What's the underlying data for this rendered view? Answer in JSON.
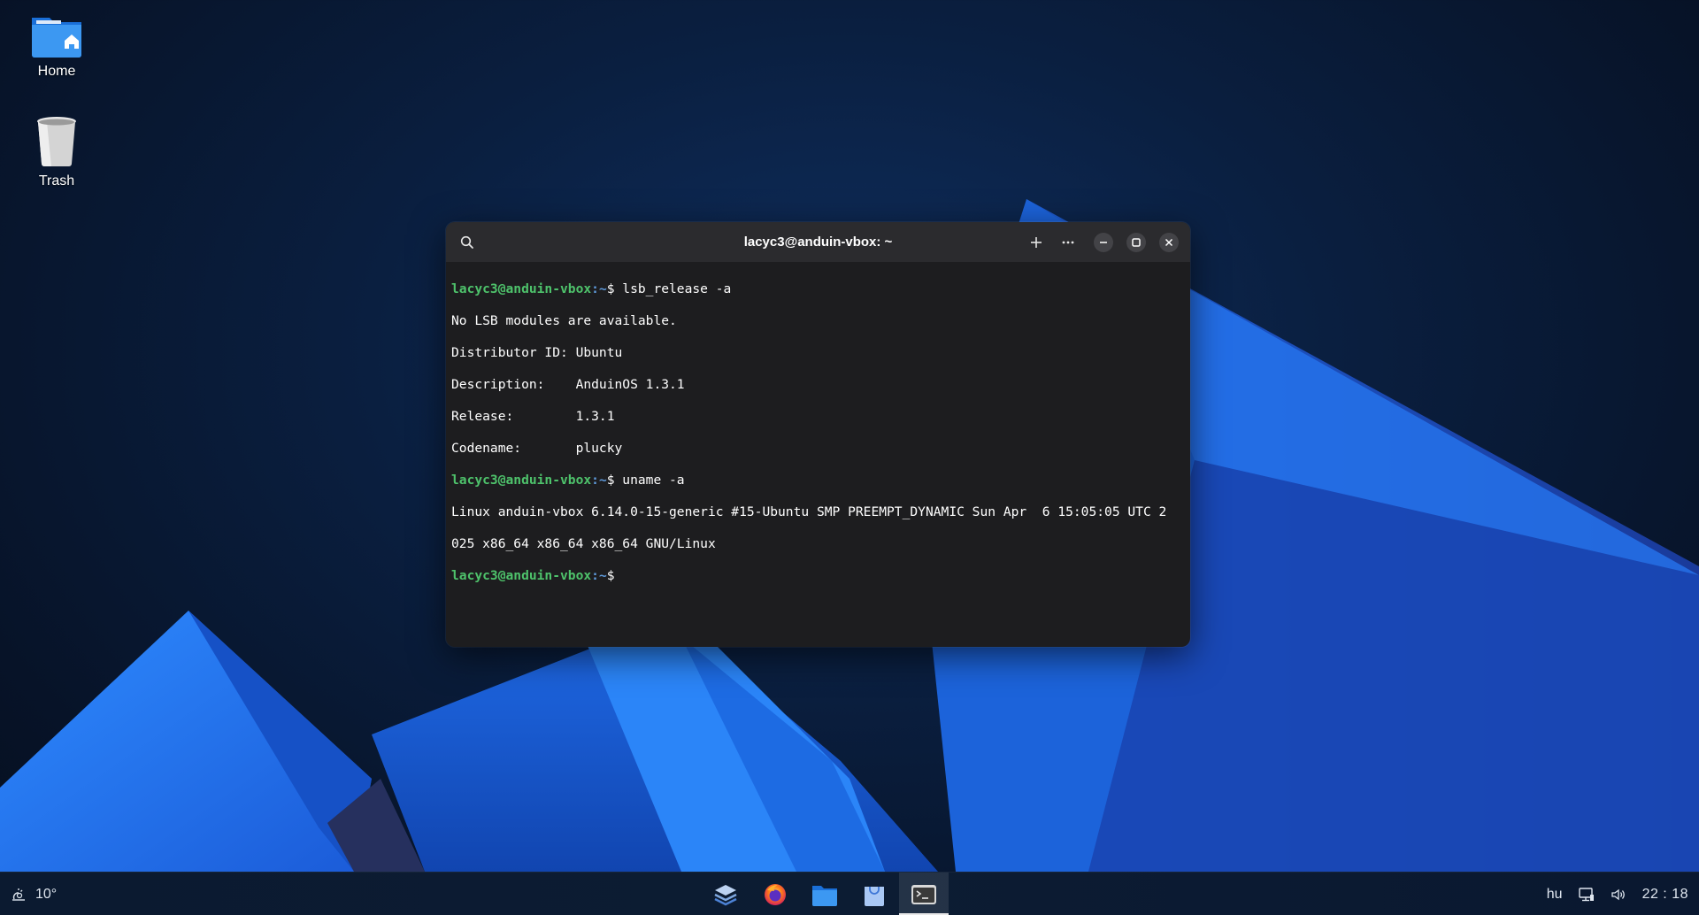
{
  "desktop": {
    "icons": [
      {
        "label": "Home",
        "icon": "home-folder-icon"
      },
      {
        "label": "Trash",
        "icon": "trash-icon"
      }
    ]
  },
  "terminal": {
    "title": "lacyc3@anduin-vbox: ~",
    "prompt_user": "lacyc3@anduin-vbox",
    "prompt_path": ":~",
    "lines": [
      {
        "type": "prompt",
        "command": "$ lsb_release -a"
      },
      {
        "type": "output",
        "text": "No LSB modules are available."
      },
      {
        "type": "output",
        "text": "Distributor ID: Ubuntu"
      },
      {
        "type": "output",
        "text": "Description:    AnduinOS 1.3.1"
      },
      {
        "type": "output",
        "text": "Release:        1.3.1"
      },
      {
        "type": "output",
        "text": "Codename:       plucky"
      },
      {
        "type": "prompt",
        "command": "$ uname -a"
      },
      {
        "type": "output",
        "text": "Linux anduin-vbox 6.14.0-15-generic #15-Ubuntu SMP PREEMPT_DYNAMIC Sun Apr  6 15:05:05 UTC 2"
      },
      {
        "type": "output",
        "text": "025 x86_64 x86_64 x86_64 GNU/Linux"
      },
      {
        "type": "prompt",
        "command": "$"
      }
    ],
    "buttons": {
      "search": "search-icon",
      "new_tab": "plus-icon",
      "menu": "more-icon",
      "minimize": "minimize-icon",
      "maximize": "maximize-icon",
      "close": "close-icon"
    }
  },
  "taskbar": {
    "weather": {
      "icon": "weather-icon",
      "temperature": "10°"
    },
    "apps": [
      {
        "name": "app-launcher",
        "icon": "stack-icon",
        "active": false
      },
      {
        "name": "firefox",
        "icon": "firefox-icon",
        "active": false
      },
      {
        "name": "files",
        "icon": "files-icon",
        "active": false
      },
      {
        "name": "software-store",
        "icon": "store-icon",
        "active": false
      },
      {
        "name": "terminal",
        "icon": "terminal-icon",
        "active": true
      }
    ],
    "tray": {
      "keyboard_layout": "hu",
      "network_icon": "network-icon",
      "volume_icon": "volume-icon",
      "clock": "22 : 18"
    }
  },
  "colors": {
    "prompt_user": "#4ec26b",
    "prompt_path": "#5f9bdc",
    "accent_blue": "#1e6fe0"
  }
}
